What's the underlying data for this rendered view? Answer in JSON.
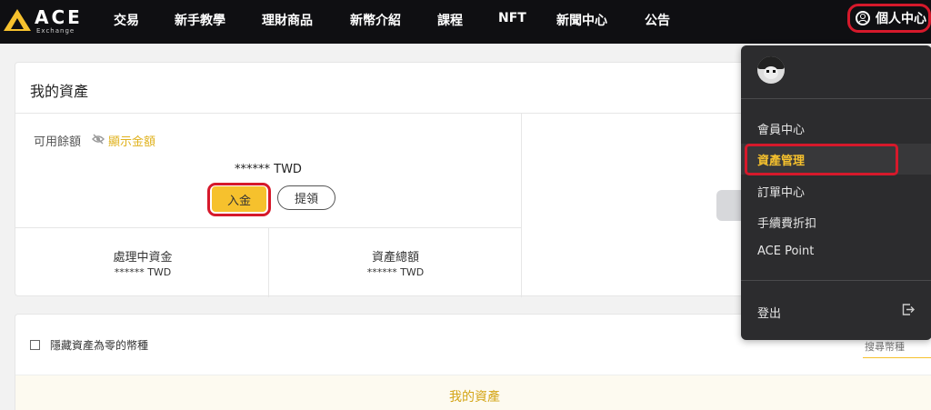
{
  "nav": {
    "logo_text": "ACE",
    "logo_sub": "Exchange",
    "items": [
      "交易",
      "新手教學",
      "理財商品",
      "新幣介紹",
      "課程",
      "NFT",
      "新聞中心",
      "公告"
    ],
    "profile_label": "個人中心"
  },
  "assets": {
    "title": "我的資產",
    "available_label": "可用餘額",
    "show_amount_label": "顯示金額",
    "balance": "******  TWD",
    "deposit_label": "入金",
    "withdraw_label": "提領",
    "processing_label": "處理中資金",
    "processing_value": "****** TWD",
    "total_label": "資產總額",
    "total_value": "****** TWD"
  },
  "list": {
    "hide_zero_label": "隱藏資產為零的幣種",
    "search_placeholder": "搜尋幣種",
    "tab_label": "我的資產"
  },
  "menu": {
    "items": [
      "會員中心",
      "資產管理",
      "訂單中心",
      "手續費折扣",
      "ACE Point"
    ],
    "active_index": 1,
    "logout_label": "登出"
  },
  "colors": {
    "accent": "#f6c12d",
    "highlight_outline": "#d6192b",
    "nav_bg": "#0f0f12",
    "menu_bg": "#2c2c2e"
  }
}
